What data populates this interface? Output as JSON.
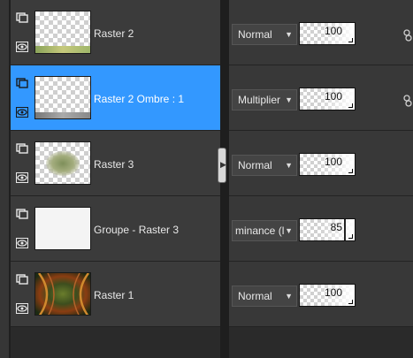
{
  "layers": [
    {
      "name": "Raster 2",
      "blend": "Normal",
      "opacity": "100",
      "linked": true
    },
    {
      "name": "Raster 2 Ombre : 1",
      "blend": "Multiplier",
      "opacity": "100",
      "linked": true,
      "selected": true
    },
    {
      "name": "Raster 3",
      "blend": "Normal",
      "opacity": "100",
      "linked": false
    },
    {
      "name": "Groupe - Raster 3",
      "blend": "minance (l",
      "opacity": "85",
      "linked": false
    },
    {
      "name": "Raster 1",
      "blend": "Normal",
      "opacity": "100",
      "linked": false
    }
  ],
  "colors": {
    "selected_row": "#3398ff",
    "row_bg": "#3b3b3b",
    "panel_bg": "#2b2b2b"
  },
  "icons": {
    "mask": "layer-mask-icon",
    "visibility": "eye-icon",
    "link": "link-icon",
    "dropdown": "chevron-down-icon",
    "splitter": "chevron-right-icon"
  }
}
